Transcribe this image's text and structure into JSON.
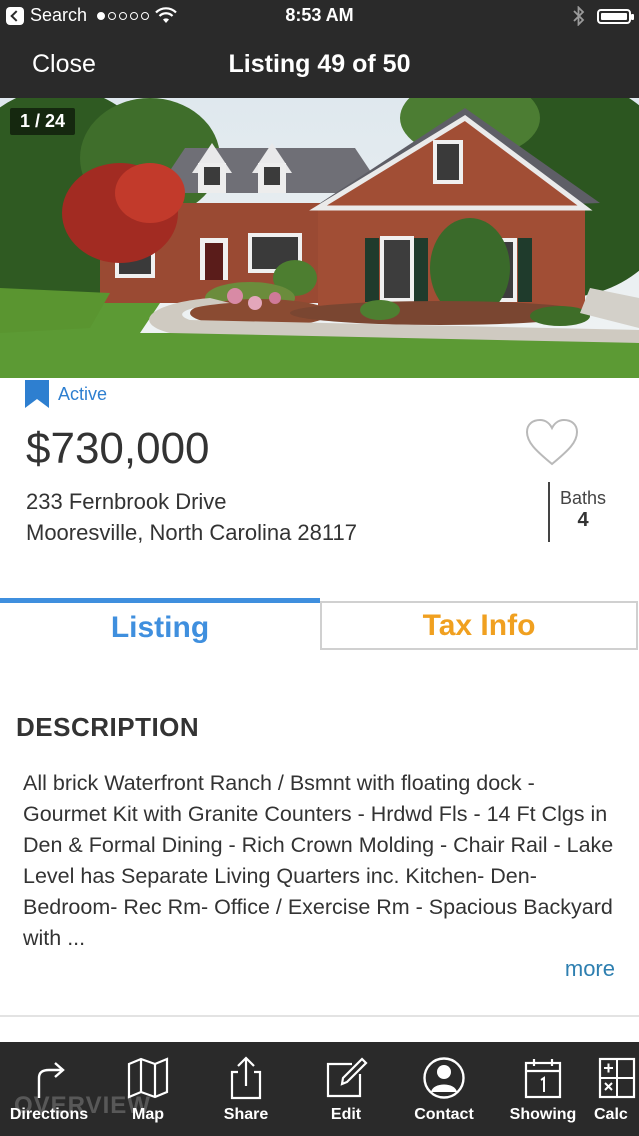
{
  "status_bar": {
    "carrier": "Search",
    "time": "8:53 AM"
  },
  "nav": {
    "close_label": "Close",
    "title": "Listing 49 of 50"
  },
  "photo": {
    "counter": "1 / 24"
  },
  "listing": {
    "status": "Active",
    "status_color": "#2e7fd0",
    "price": "$730,000",
    "address_line1": "233 Fernbrook Drive",
    "address_line2": "Mooresville, North Carolina 28117",
    "baths_label": "Baths",
    "baths_value": "4"
  },
  "tabs": {
    "listing_label": "Listing",
    "tax_label": "Tax Info",
    "active": "Listing",
    "listing_color": "#3f8fde",
    "tax_color": "#f0a020"
  },
  "description": {
    "heading": "DESCRIPTION",
    "text": "All brick Waterfront Ranch / Bsmnt with floating dock - Gourmet Kit with Granite Counters - Hrdwd Fls - 14 Ft Clgs in Den & Formal Dining - Rich Crown Molding - Chair Rail - Lake Level has Separate Living Quarters inc. Kitchen- Den- Bedroom- Rec Rm- Office / Exercise Rm - Spacious Backyard with ...",
    "more_label": "more"
  },
  "toolbar": {
    "overview_ghost": "OVERVIEW",
    "items": [
      {
        "label": "Directions",
        "icon": "directions-arrow-icon"
      },
      {
        "label": "Map",
        "icon": "map-icon"
      },
      {
        "label": "Share",
        "icon": "share-icon"
      },
      {
        "label": "Edit",
        "icon": "edit-icon"
      },
      {
        "label": "Contact",
        "icon": "contact-icon"
      },
      {
        "label": "Showing",
        "icon": "calendar-icon"
      },
      {
        "label": "Calc",
        "icon": "calculator-icon"
      }
    ]
  }
}
